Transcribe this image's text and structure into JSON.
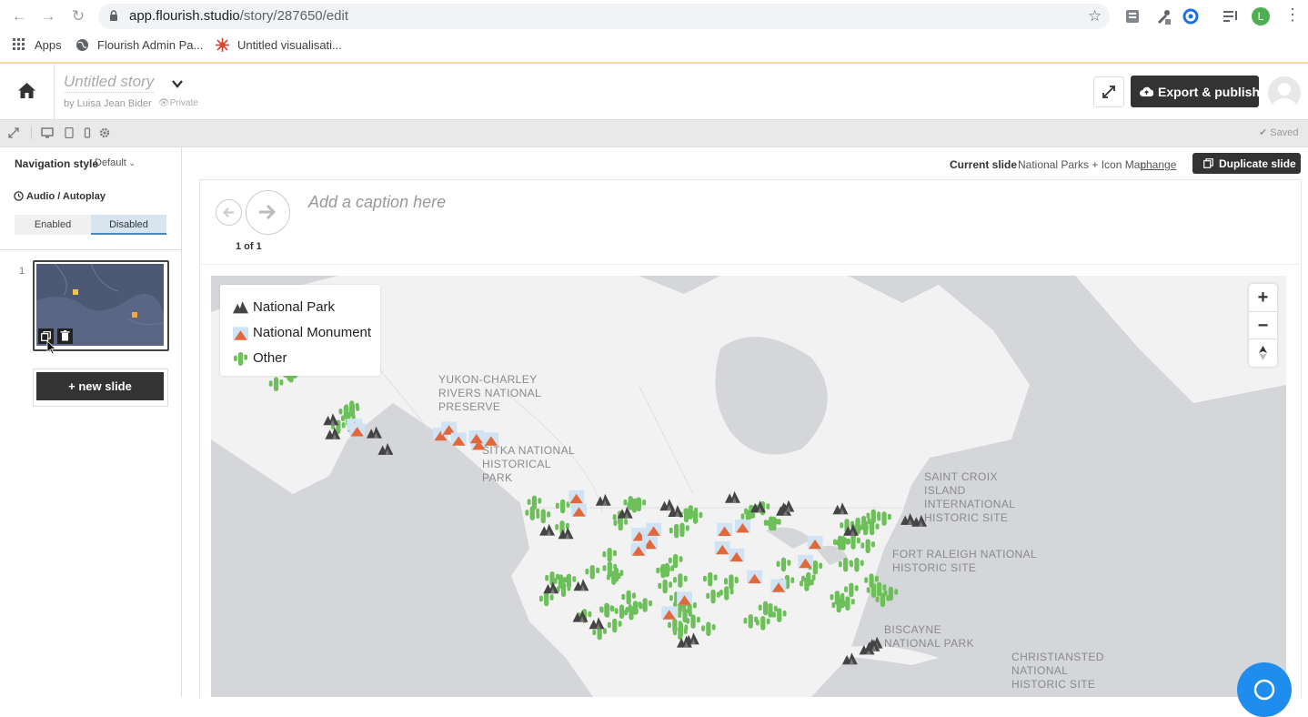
{
  "browser": {
    "url_host": "app.flourish.studio",
    "url_path": "/story/287650/edit",
    "bookmarks": [
      "Apps",
      "Flourish Admin Pa...",
      "Untitled visualisati..."
    ],
    "profile_initial": "L"
  },
  "header": {
    "story_title": "Untitled story",
    "by_line": "by Luisa Jean Bider",
    "privacy": "Private",
    "export_label": "Export & publish"
  },
  "toolbar": {
    "saved_label": "Saved"
  },
  "sidebar": {
    "nav_style_label": "Navigation style",
    "nav_style_value": "Default",
    "audio_label": "Audio / Autoplay",
    "audio_options": [
      "Enabled",
      "Disabled"
    ],
    "audio_selected": "Disabled",
    "slide_number": "1",
    "new_slide_label": "+ new slide"
  },
  "main": {
    "current_slide_label": "Current slide",
    "current_slide_name": "National Parks + Icon Map",
    "change_label": "change",
    "duplicate_label": "Duplicate slide",
    "caption_placeholder": "Add a caption here",
    "page_count": "1 of 1"
  },
  "map": {
    "legend": [
      "National Park",
      "National Monument",
      "Other"
    ],
    "labels": [
      "YUKON-CHARLEY RIVERS NATIONAL PRESERVE",
      "SITKA NATIONAL HISTORICAL PARK",
      "SAINT CROIX ISLAND INTERNATIONAL HISTORIC SITE",
      "FORT RALEIGH NATIONAL HISTORIC SITE",
      "BISCAYNE NATIONAL PARK",
      "CHRISTIANSTED NATIONAL HISTORIC SITE"
    ],
    "zoom_in": "+",
    "zoom_out": "−"
  },
  "colors": {
    "dark_button": "#333333",
    "selected_segment": "#d8e5f0",
    "map_water": "#d4d6da",
    "map_land": "#f2f2f2",
    "cactus_green": "#6dbf5a",
    "help_blue": "#1f8ded"
  }
}
